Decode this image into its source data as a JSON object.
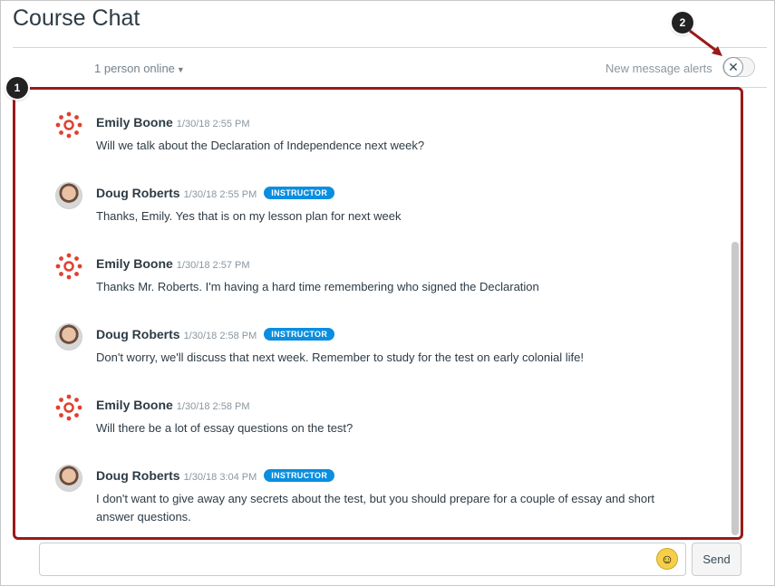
{
  "header": {
    "title": "Course Chat",
    "online_status": "1 person online",
    "alerts_label": "New message alerts"
  },
  "messages": [
    {
      "name": "Emily Boone",
      "time": "1/30/18 2:55 PM",
      "role": "",
      "avatar": "canvas-logo-avatar",
      "text": "Will we talk about the Declaration of Independence next week?"
    },
    {
      "name": "Doug Roberts",
      "time": "1/30/18 2:55 PM",
      "role": "INSTRUCTOR",
      "avatar": "user-photo-avatar",
      "text": "Thanks, Emily. Yes that is on my lesson plan for next week"
    },
    {
      "name": "Emily Boone",
      "time": "1/30/18 2:57 PM",
      "role": "",
      "avatar": "canvas-logo-avatar",
      "text": "Thanks Mr. Roberts. I'm having a hard time remembering who signed the Declaration"
    },
    {
      "name": "Doug Roberts",
      "time": "1/30/18 2:58 PM",
      "role": "INSTRUCTOR",
      "avatar": "user-photo-avatar",
      "text": "Don't worry, we'll discuss that next week. Remember to study for the test on early colonial life!"
    },
    {
      "name": "Emily Boone",
      "time": "1/30/18 2:58 PM",
      "role": "",
      "avatar": "canvas-logo-avatar",
      "text": "Will there be a lot of essay questions on the test?"
    },
    {
      "name": "Doug Roberts",
      "time": "1/30/18 3:04 PM",
      "role": "INSTRUCTOR",
      "avatar": "user-photo-avatar",
      "text": "I don't want to give away any secrets about the test, but you should prepare for a couple of essay and short answer questions."
    }
  ],
  "composer": {
    "placeholder": "",
    "send_label": "Send",
    "emoji_icon": "smiley-icon"
  },
  "callouts": [
    "1",
    "2"
  ],
  "colors": {
    "callout_box": "#9a1a1a",
    "instructor_badge": "#0a8ee0",
    "logo_red": "#e0402f"
  }
}
